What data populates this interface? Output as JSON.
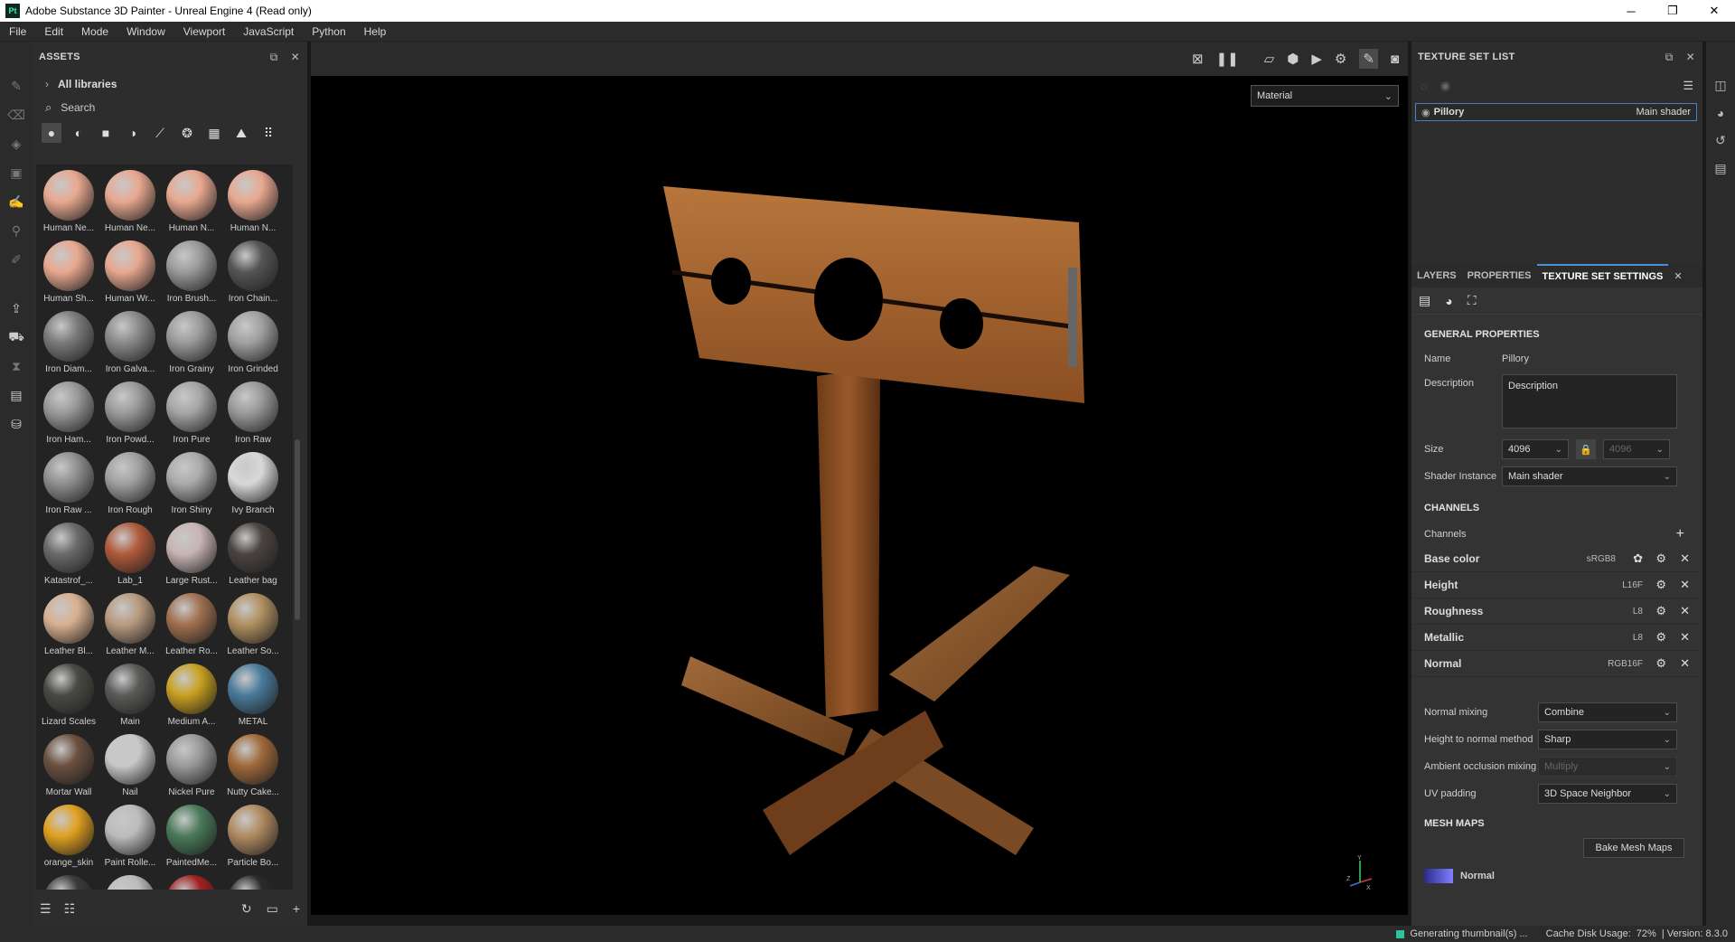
{
  "window": {
    "app_badge": "Pt",
    "title": "Adobe Substance 3D Painter - Unreal Engine 4 (Read only)",
    "controls": [
      "─",
      "❐",
      "✕"
    ]
  },
  "menu": [
    "File",
    "Edit",
    "Mode",
    "Window",
    "Viewport",
    "JavaScript",
    "Python",
    "Help"
  ],
  "assets": {
    "title": "ASSETS",
    "libraries": "All libraries",
    "search_placeholder": "Search",
    "items": [
      {
        "label": "Human Ne...",
        "color": "#e8a890"
      },
      {
        "label": "Human Ne...",
        "color": "#e8a890"
      },
      {
        "label": "Human N...",
        "color": "#e8a890"
      },
      {
        "label": "Human N...",
        "color": "#e8a890"
      },
      {
        "label": "Human Sh...",
        "color": "#e8a890"
      },
      {
        "label": "Human Wr...",
        "color": "#e8a890"
      },
      {
        "label": "Iron Brush...",
        "color": "#9a9a9a"
      },
      {
        "label": "Iron Chain...",
        "color": "#555555"
      },
      {
        "label": "Iron Diam...",
        "color": "#7a7a7a"
      },
      {
        "label": "Iron Galva...",
        "color": "#8a8a8a"
      },
      {
        "label": "Iron Grainy",
        "color": "#9a9a9a"
      },
      {
        "label": "Iron Grinded",
        "color": "#a0a0a0"
      },
      {
        "label": "Iron Ham...",
        "color": "#999999"
      },
      {
        "label": "Iron Powd...",
        "color": "#9a9a9a"
      },
      {
        "label": "Iron Pure",
        "color": "#a5a5a5"
      },
      {
        "label": "Iron Raw",
        "color": "#9a9a9a"
      },
      {
        "label": "Iron Raw ...",
        "color": "#8f8f8f"
      },
      {
        "label": "Iron Rough",
        "color": "#a0a0a0"
      },
      {
        "label": "Iron Shiny",
        "color": "#aaaaaa"
      },
      {
        "label": "Ivy Branch",
        "color": "#d8d8d8"
      },
      {
        "label": "Katastrof_...",
        "color": "#6a6a6a"
      },
      {
        "label": "Lab_1",
        "color": "#b05a3a"
      },
      {
        "label": "Large Rust...",
        "color": "#c8b4b4"
      },
      {
        "label": "Leather bag",
        "color": "#4a4440"
      },
      {
        "label": "Leather Bl...",
        "color": "#d8b090"
      },
      {
        "label": "Leather M...",
        "color": "#b89a80"
      },
      {
        "label": "Leather Ro...",
        "color": "#a07050"
      },
      {
        "label": "Leather So...",
        "color": "#b09060"
      },
      {
        "label": "Lizard Scales",
        "color": "#4a4a44"
      },
      {
        "label": "Main",
        "color": "#5a5a58"
      },
      {
        "label": "Medium A...",
        "color": "#c8a020"
      },
      {
        "label": "METAL",
        "color": "#4a7a9a"
      },
      {
        "label": "Mortar Wall",
        "color": "#6a5040"
      },
      {
        "label": "Nail",
        "color": "#c8c8c8"
      },
      {
        "label": "Nickel Pure",
        "color": "#9a9a9a"
      },
      {
        "label": "Nutty Cake...",
        "color": "#a06a3a"
      },
      {
        "label": "orange_skin",
        "color": "#e0a020"
      },
      {
        "label": "Paint Rolle...",
        "color": "#bcbcbc"
      },
      {
        "label": "PaintedMe...",
        "color": "#4a7a5a"
      },
      {
        "label": "Particle Bo...",
        "color": "#b08a60"
      },
      {
        "label": "",
        "color": "#3a3a3a"
      },
      {
        "label": "",
        "color": "#bcbcbc"
      },
      {
        "label": "",
        "color": "#a02020"
      },
      {
        "label": "",
        "color": "#2a2a2a"
      }
    ]
  },
  "viewport": {
    "mode_select": "Material",
    "axis_x": "X",
    "axis_y": "Y",
    "axis_z": "Z"
  },
  "texture_set_list": {
    "title": "TEXTURE SET LIST",
    "row_name": "Pillory",
    "row_shader": "Main shader"
  },
  "tabs": {
    "layers": "LAYERS",
    "properties": "PROPERTIES",
    "texture_set_settings": "TEXTURE SET SETTINGS"
  },
  "settings": {
    "general_title": "GENERAL PROPERTIES",
    "name_label": "Name",
    "name_value": "Pillory",
    "description_label": "Description",
    "description_value": "Description",
    "size_label": "Size",
    "size_value": "4096",
    "size_value_locked": "4096",
    "shader_label": "Shader Instance",
    "shader_value": "Main shader",
    "channels_title": "CHANNELS",
    "channels_label": "Channels",
    "channels": [
      {
        "name": "Base color",
        "format": "sRGB8"
      },
      {
        "name": "Height",
        "format": "L16F"
      },
      {
        "name": "Roughness",
        "format": "L8"
      },
      {
        "name": "Metallic",
        "format": "L8"
      },
      {
        "name": "Normal",
        "format": "RGB16F"
      }
    ],
    "normal_mixing_label": "Normal mixing",
    "normal_mixing_value": "Combine",
    "height_normal_label": "Height to normal method",
    "height_normal_value": "Sharp",
    "ao_mixing_label": "Ambient occlusion mixing",
    "ao_mixing_value": "Multiply",
    "uv_padding_label": "UV padding",
    "uv_padding_value": "3D Space Neighbor",
    "mesh_maps_title": "MESH MAPS",
    "bake_label": "Bake Mesh Maps",
    "mesh_map_first": "Normal"
  },
  "status": {
    "generating": "Generating thumbnail(s) ...",
    "cache": "Cache Disk Usage:",
    "cache_value": "72%",
    "version": "| Version: 8.3.0"
  }
}
